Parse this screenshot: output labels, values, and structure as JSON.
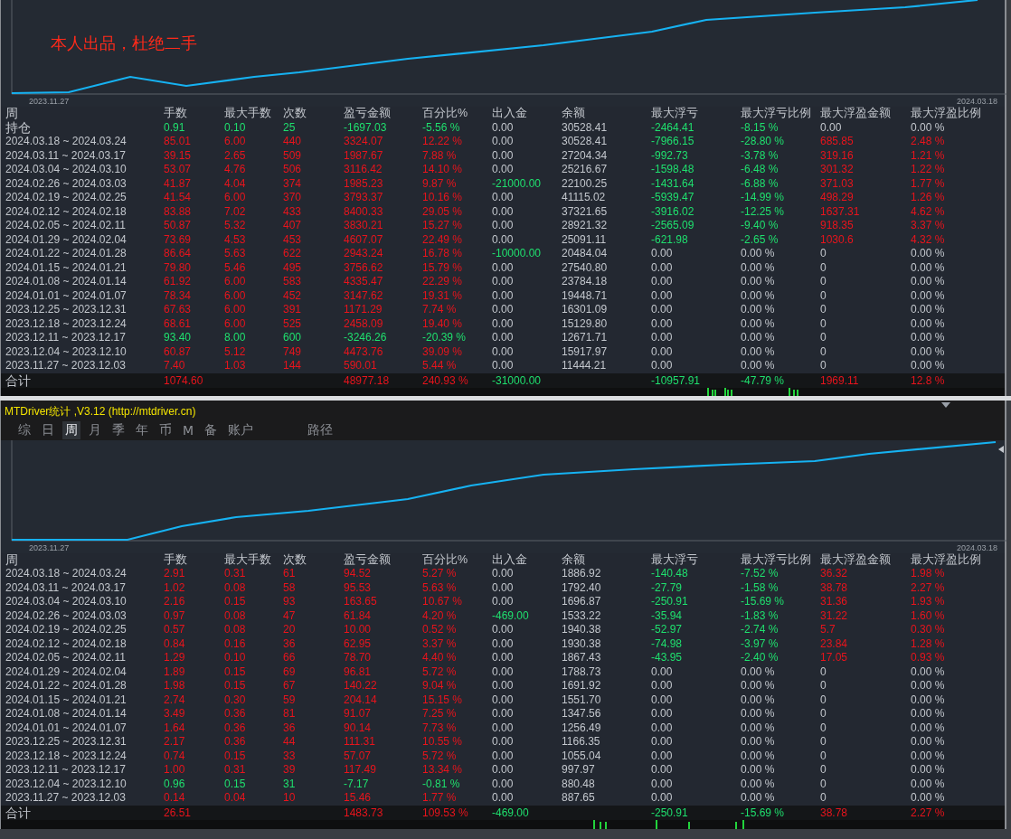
{
  "top_panel": {
    "overlay_note": "本人出品，杜绝二手",
    "chart": {
      "start_label": "2023.11.27",
      "end_label": "2024.03.18"
    },
    "table": {
      "columns": [
        "周",
        "手数",
        "最大手数",
        "次数",
        "盈亏金额",
        "百分比%",
        "出入金",
        "余额",
        "最大浮亏",
        "最大浮亏比例",
        "最大浮盈金额",
        "最大浮盈比例"
      ],
      "rows": [
        {
          "cells": [
            "持仓",
            "0.91",
            "0.10",
            "25",
            "-1697.03",
            "-5.56 %",
            "0.00",
            "30528.41",
            "-2464.41",
            "-8.15 %",
            "0.00",
            "0.00 %"
          ],
          "loss": true,
          "withdrawal": false,
          "float_loss": true,
          "float_gain": false
        },
        {
          "cells": [
            "2024.03.18 ~ 2024.03.24",
            "85.01",
            "6.00",
            "440",
            "3324.07",
            "12.22 %",
            "0.00",
            "30528.41",
            "-7966.15",
            "-28.80 %",
            "685.85",
            "2.48 %"
          ],
          "loss": false,
          "withdrawal": false,
          "float_loss": true,
          "float_gain": true
        },
        {
          "cells": [
            "2024.03.11 ~ 2024.03.17",
            "39.15",
            "2.65",
            "509",
            "1987.67",
            "7.88 %",
            "0.00",
            "27204.34",
            "-992.73",
            "-3.78 %",
            "319.16",
            "1.21 %"
          ],
          "loss": false,
          "withdrawal": false,
          "float_loss": true,
          "float_gain": true
        },
        {
          "cells": [
            "2024.03.04 ~ 2024.03.10",
            "53.07",
            "4.76",
            "506",
            "3116.42",
            "14.10 %",
            "0.00",
            "25216.67",
            "-1598.48",
            "-6.48 %",
            "301.32",
            "1.22 %"
          ],
          "loss": false,
          "withdrawal": false,
          "float_loss": true,
          "float_gain": true
        },
        {
          "cells": [
            "2024.02.26 ~ 2024.03.03",
            "41.87",
            "4.04",
            "374",
            "1985.23",
            "9.87 %",
            "-21000.00",
            "22100.25",
            "-1431.64",
            "-6.88 %",
            "371.03",
            "1.77 %"
          ],
          "loss": false,
          "withdrawal": true,
          "float_loss": true,
          "float_gain": true
        },
        {
          "cells": [
            "2024.02.19 ~ 2024.02.25",
            "41.54",
            "6.00",
            "370",
            "3793.37",
            "10.16 %",
            "0.00",
            "41115.02",
            "-5939.47",
            "-14.99 %",
            "498.29",
            "1.26 %"
          ],
          "loss": false,
          "withdrawal": false,
          "float_loss": true,
          "float_gain": true
        },
        {
          "cells": [
            "2024.02.12 ~ 2024.02.18",
            "83.88",
            "7.02",
            "433",
            "8400.33",
            "29.05 %",
            "0.00",
            "37321.65",
            "-3916.02",
            "-12.25 %",
            "1637.31",
            "4.62 %"
          ],
          "loss": false,
          "withdrawal": false,
          "float_loss": true,
          "float_gain": true
        },
        {
          "cells": [
            "2024.02.05 ~ 2024.02.11",
            "50.87",
            "5.32",
            "407",
            "3830.21",
            "15.27 %",
            "0.00",
            "28921.32",
            "-2565.09",
            "-9.40 %",
            "918.35",
            "3.37 %"
          ],
          "loss": false,
          "withdrawal": false,
          "float_loss": true,
          "float_gain": true
        },
        {
          "cells": [
            "2024.01.29 ~ 2024.02.04",
            "73.69",
            "4.53",
            "453",
            "4607.07",
            "22.49 %",
            "0.00",
            "25091.11",
            "-621.98",
            "-2.65 %",
            "1030.6",
            "4.32 %"
          ],
          "loss": false,
          "withdrawal": false,
          "float_loss": true,
          "float_gain": true
        },
        {
          "cells": [
            "2024.01.22 ~ 2024.01.28",
            "86.64",
            "5.63",
            "622",
            "2943.24",
            "16.78 %",
            "-10000.00",
            "20484.04",
            "0.00",
            "0.00 %",
            "0",
            "0.00 %"
          ],
          "loss": false,
          "withdrawal": true,
          "float_loss": false,
          "float_gain": false
        },
        {
          "cells": [
            "2024.01.15 ~ 2024.01.21",
            "79.80",
            "5.46",
            "495",
            "3756.62",
            "15.79 %",
            "0.00",
            "27540.80",
            "0.00",
            "0.00 %",
            "0",
            "0.00 %"
          ],
          "loss": false,
          "withdrawal": false,
          "float_loss": false,
          "float_gain": false
        },
        {
          "cells": [
            "2024.01.08 ~ 2024.01.14",
            "61.92",
            "6.00",
            "583",
            "4335.47",
            "22.29 %",
            "0.00",
            "23784.18",
            "0.00",
            "0.00 %",
            "0",
            "0.00 %"
          ],
          "loss": false,
          "withdrawal": false,
          "float_loss": false,
          "float_gain": false
        },
        {
          "cells": [
            "2024.01.01 ~ 2024.01.07",
            "78.34",
            "6.00",
            "452",
            "3147.62",
            "19.31 %",
            "0.00",
            "19448.71",
            "0.00",
            "0.00 %",
            "0",
            "0.00 %"
          ],
          "loss": false,
          "withdrawal": false,
          "float_loss": false,
          "float_gain": false
        },
        {
          "cells": [
            "2023.12.25 ~ 2023.12.31",
            "67.63",
            "6.00",
            "391",
            "1171.29",
            "7.74 %",
            "0.00",
            "16301.09",
            "0.00",
            "0.00 %",
            "0",
            "0.00 %"
          ],
          "loss": false,
          "withdrawal": false,
          "float_loss": false,
          "float_gain": false
        },
        {
          "cells": [
            "2023.12.18 ~ 2023.12.24",
            "68.61",
            "6.00",
            "525",
            "2458.09",
            "19.40 %",
            "0.00",
            "15129.80",
            "0.00",
            "0.00 %",
            "0",
            "0.00 %"
          ],
          "loss": false,
          "withdrawal": false,
          "float_loss": false,
          "float_gain": false
        },
        {
          "cells": [
            "2023.12.11 ~ 2023.12.17",
            "93.40",
            "8.00",
            "600",
            "-3246.26",
            "-20.39 %",
            "0.00",
            "12671.71",
            "0.00",
            "0.00 %",
            "0",
            "0.00 %"
          ],
          "loss": true,
          "withdrawal": false,
          "float_loss": false,
          "float_gain": false
        },
        {
          "cells": [
            "2023.12.04 ~ 2023.12.10",
            "60.87",
            "5.12",
            "749",
            "4473.76",
            "39.09 %",
            "0.00",
            "15917.97",
            "0.00",
            "0.00 %",
            "0",
            "0.00 %"
          ],
          "loss": false,
          "withdrawal": false,
          "float_loss": false,
          "float_gain": false
        },
        {
          "cells": [
            "2023.11.27 ~ 2023.12.03",
            "7.40",
            "1.03",
            "144",
            "590.01",
            "5.44 %",
            "0.00",
            "11444.21",
            "0.00",
            "0.00 %",
            "0",
            "0.00 %"
          ],
          "loss": false,
          "withdrawal": false,
          "float_loss": false,
          "float_gain": false
        }
      ],
      "total": {
        "label": "合计",
        "lots": "1074.60",
        "pnl": "48977.18",
        "percent": "240.93 %",
        "flow": "-31000.00",
        "max_float_loss": "-10957.91",
        "max_float_loss_pct": "-47.79 %",
        "max_float_gain": "1969.11",
        "max_float_gain_pct": "12.8 %",
        "loss": false,
        "withdrawal": true,
        "float_loss": true,
        "float_gain": true
      }
    }
  },
  "bottom_panel": {
    "title": "MTDriver统计 ,V3.12 (http://mtdriver.cn)",
    "tabs": [
      {
        "label": "综",
        "selected": false
      },
      {
        "label": "日",
        "selected": false
      },
      {
        "label": "周",
        "selected": true
      },
      {
        "label": "月",
        "selected": false
      },
      {
        "label": "季",
        "selected": false
      },
      {
        "label": "年",
        "selected": false
      },
      {
        "label": "币",
        "selected": false
      },
      {
        "label": "M",
        "selected": false
      },
      {
        "label": "备",
        "selected": false
      },
      {
        "label": "账户",
        "selected": false
      }
    ],
    "path_tab": {
      "label": "路径",
      "selected": false
    },
    "chart": {
      "start_label": "2023.11.27",
      "end_label": "2024.03.18"
    },
    "table": {
      "columns": [
        "周",
        "手数",
        "最大手数",
        "次数",
        "盈亏金额",
        "百分比%",
        "出入金",
        "余额",
        "最大浮亏",
        "最大浮亏比例",
        "最大浮盈金额",
        "最大浮盈比例"
      ],
      "rows": [
        {
          "cells": [
            "2024.03.18 ~ 2024.03.24",
            "2.91",
            "0.31",
            "61",
            "94.52",
            "5.27 %",
            "0.00",
            "1886.92",
            "-140.48",
            "-7.52 %",
            "36.32",
            "1.98 %"
          ],
          "loss": false,
          "withdrawal": false,
          "float_loss": true,
          "float_gain": true
        },
        {
          "cells": [
            "2024.03.11 ~ 2024.03.17",
            "1.02",
            "0.08",
            "58",
            "95.53",
            "5.63 %",
            "0.00",
            "1792.40",
            "-27.79",
            "-1.58 %",
            "38.78",
            "2.27 %"
          ],
          "loss": false,
          "withdrawal": false,
          "float_loss": true,
          "float_gain": true
        },
        {
          "cells": [
            "2024.03.04 ~ 2024.03.10",
            "2.16",
            "0.15",
            "93",
            "163.65",
            "10.67 %",
            "0.00",
            "1696.87",
            "-250.91",
            "-15.69 %",
            "31.36",
            "1.93 %"
          ],
          "loss": false,
          "withdrawal": false,
          "float_loss": true,
          "float_gain": true
        },
        {
          "cells": [
            "2024.02.26 ~ 2024.03.03",
            "0.97",
            "0.08",
            "47",
            "61.84",
            "4.20 %",
            "-469.00",
            "1533.22",
            "-35.94",
            "-1.83 %",
            "31.22",
            "1.60 %"
          ],
          "loss": false,
          "withdrawal": true,
          "float_loss": true,
          "float_gain": true
        },
        {
          "cells": [
            "2024.02.19 ~ 2024.02.25",
            "0.57",
            "0.08",
            "20",
            "10.00",
            "0.52 %",
            "0.00",
            "1940.38",
            "-52.97",
            "-2.74 %",
            "5.7",
            "0.30 %"
          ],
          "loss": false,
          "withdrawal": false,
          "float_loss": true,
          "float_gain": true
        },
        {
          "cells": [
            "2024.02.12 ~ 2024.02.18",
            "0.84",
            "0.16",
            "36",
            "62.95",
            "3.37 %",
            "0.00",
            "1930.38",
            "-74.98",
            "-3.97 %",
            "23.84",
            "1.28 %"
          ],
          "loss": false,
          "withdrawal": false,
          "float_loss": true,
          "float_gain": true
        },
        {
          "cells": [
            "2024.02.05 ~ 2024.02.11",
            "1.29",
            "0.10",
            "66",
            "78.70",
            "4.40 %",
            "0.00",
            "1867.43",
            "-43.95",
            "-2.40 %",
            "17.05",
            "0.93 %"
          ],
          "loss": false,
          "withdrawal": false,
          "float_loss": true,
          "float_gain": true
        },
        {
          "cells": [
            "2024.01.29 ~ 2024.02.04",
            "1.89",
            "0.15",
            "69",
            "96.81",
            "5.72 %",
            "0.00",
            "1788.73",
            "0.00",
            "0.00 %",
            "0",
            "0.00 %"
          ],
          "loss": false,
          "withdrawal": false,
          "float_loss": false,
          "float_gain": false
        },
        {
          "cells": [
            "2024.01.22 ~ 2024.01.28",
            "1.98",
            "0.15",
            "67",
            "140.22",
            "9.04 %",
            "0.00",
            "1691.92",
            "0.00",
            "0.00 %",
            "0",
            "0.00 %"
          ],
          "loss": false,
          "withdrawal": false,
          "float_loss": false,
          "float_gain": false
        },
        {
          "cells": [
            "2024.01.15 ~ 2024.01.21",
            "2.74",
            "0.30",
            "59",
            "204.14",
            "15.15 %",
            "0.00",
            "1551.70",
            "0.00",
            "0.00 %",
            "0",
            "0.00 %"
          ],
          "loss": false,
          "withdrawal": false,
          "float_loss": false,
          "float_gain": false
        },
        {
          "cells": [
            "2024.01.08 ~ 2024.01.14",
            "3.49",
            "0.36",
            "81",
            "91.07",
            "7.25 %",
            "0.00",
            "1347.56",
            "0.00",
            "0.00 %",
            "0",
            "0.00 %"
          ],
          "loss": false,
          "withdrawal": false,
          "float_loss": false,
          "float_gain": false
        },
        {
          "cells": [
            "2024.01.01 ~ 2024.01.07",
            "1.64",
            "0.36",
            "36",
            "90.14",
            "7.73 %",
            "0.00",
            "1256.49",
            "0.00",
            "0.00 %",
            "0",
            "0.00 %"
          ],
          "loss": false,
          "withdrawal": false,
          "float_loss": false,
          "float_gain": false
        },
        {
          "cells": [
            "2023.12.25 ~ 2023.12.31",
            "2.17",
            "0.36",
            "44",
            "111.31",
            "10.55 %",
            "0.00",
            "1166.35",
            "0.00",
            "0.00 %",
            "0",
            "0.00 %"
          ],
          "loss": false,
          "withdrawal": false,
          "float_loss": false,
          "float_gain": false
        },
        {
          "cells": [
            "2023.12.18 ~ 2023.12.24",
            "0.74",
            "0.15",
            "33",
            "57.07",
            "5.72 %",
            "0.00",
            "1055.04",
            "0.00",
            "0.00 %",
            "0",
            "0.00 %"
          ],
          "loss": false,
          "withdrawal": false,
          "float_loss": false,
          "float_gain": false
        },
        {
          "cells": [
            "2023.12.11 ~ 2023.12.17",
            "1.00",
            "0.31",
            "39",
            "117.49",
            "13.34 %",
            "0.00",
            "997.97",
            "0.00",
            "0.00 %",
            "0",
            "0.00 %"
          ],
          "loss": false,
          "withdrawal": false,
          "float_loss": false,
          "float_gain": false
        },
        {
          "cells": [
            "2023.12.04 ~ 2023.12.10",
            "0.96",
            "0.15",
            "31",
            "-7.17",
            "-0.81 %",
            "0.00",
            "880.48",
            "0.00",
            "0.00 %",
            "0",
            "0.00 %"
          ],
          "loss": true,
          "withdrawal": false,
          "float_loss": false,
          "float_gain": false
        },
        {
          "cells": [
            "2023.11.27 ~ 2023.12.03",
            "0.14",
            "0.04",
            "10",
            "15.46",
            "1.77 %",
            "0.00",
            "887.65",
            "0.00",
            "0.00 %",
            "0",
            "0.00 %"
          ],
          "loss": false,
          "withdrawal": false,
          "float_loss": false,
          "float_gain": false
        }
      ],
      "total": {
        "label": "合计",
        "lots": "26.51",
        "pnl": "1483.73",
        "percent": "109.53 %",
        "flow": "-469.00",
        "max_float_loss": "-250.91",
        "max_float_loss_pct": "-15.69 %",
        "max_float_gain": "38.78",
        "max_float_gain_pct": "2.27 %",
        "loss": false,
        "withdrawal": true,
        "float_loss": true,
        "float_gain": true
      }
    }
  }
}
